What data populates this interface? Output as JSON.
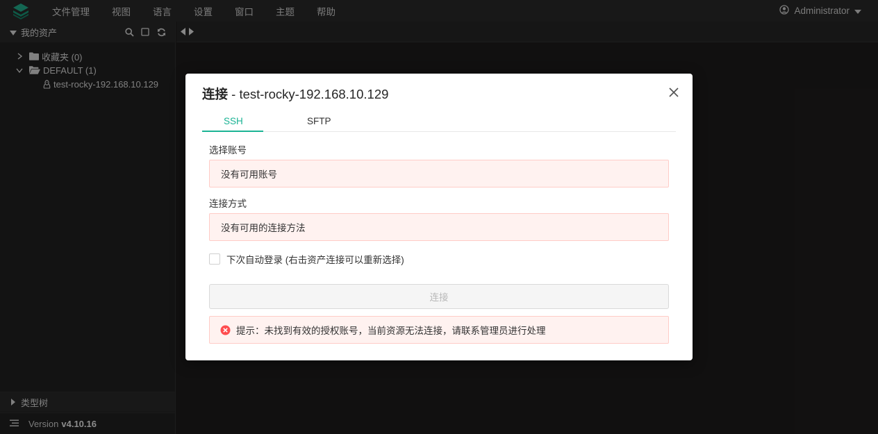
{
  "app": {
    "menu": [
      "文件管理",
      "视图",
      "语言",
      "设置",
      "窗口",
      "主题",
      "帮助"
    ],
    "user": "Administrator"
  },
  "sidebar": {
    "title": "我的资产",
    "tree": [
      {
        "label": "收藏夹 (0)"
      },
      {
        "label": "DEFAULT (1)"
      }
    ],
    "asset": "test-rocky-192.168.10.129",
    "type_tree_label": "类型树",
    "version_label": "Version",
    "version_value": "v4.10.16"
  },
  "dialog": {
    "title_prefix": "连接",
    "title_suffix": " - test-rocky-192.168.10.129",
    "tabs": [
      "SSH",
      "SFTP"
    ],
    "active_tab": "SSH",
    "account_label": "选择账号",
    "account_value": "没有可用账号",
    "method_label": "连接方式",
    "method_value": "没有可用的连接方法",
    "auto_login_label": "下次自动登录 (右击资产连接可以重新选择)",
    "auto_login_checked": false,
    "connect_button": "连接",
    "alert_text": "提示：未找到有效的授权账号，当前资源无法连接，请联系管理员进行处理"
  },
  "colors": {
    "accent": "#1ab394",
    "error_bg": "#fff2f0",
    "error_border": "#ffccc7",
    "error_icon": "#ff4d4f"
  }
}
